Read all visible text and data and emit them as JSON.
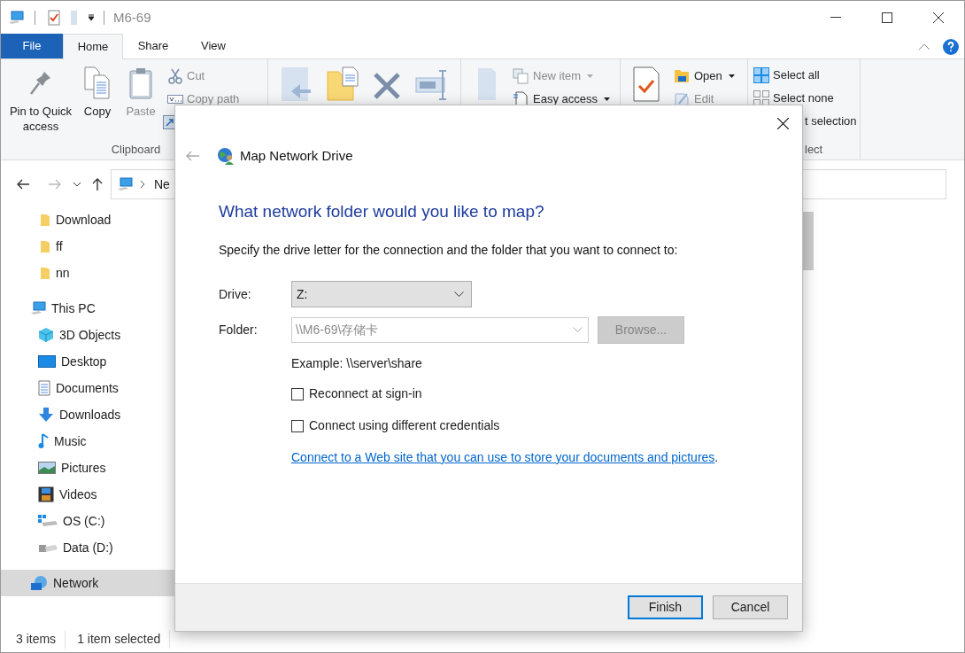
{
  "window": {
    "title": "M6-69"
  },
  "ribbon_tabs": [
    {
      "label": "File",
      "kind": "file",
      "selected": false
    },
    {
      "label": "Home",
      "kind": "tab",
      "selected": true
    },
    {
      "label": "Share",
      "kind": "tab",
      "selected": false
    },
    {
      "label": "View",
      "kind": "tab",
      "selected": false
    }
  ],
  "ribbon": {
    "clipboard": {
      "label": "Clipboard",
      "large_buttons": [
        {
          "label": "Pin to Quick access",
          "disabled": false
        },
        {
          "label": "Copy",
          "disabled": false
        },
        {
          "label": "Paste",
          "disabled": true
        }
      ],
      "small_buttons": [
        {
          "label": "Cut",
          "disabled": true
        },
        {
          "label": "Copy path",
          "disabled": true
        }
      ]
    },
    "new": {
      "small_buttons": [
        {
          "label": "New item",
          "disabled": true,
          "dropdown": true
        },
        {
          "label": "Easy access",
          "disabled": false,
          "dropdown": true
        }
      ]
    },
    "open": {
      "small_buttons": [
        {
          "label": "Open",
          "disabled": false,
          "dropdown": true
        },
        {
          "label": "Edit",
          "disabled": true,
          "dropdown": false
        }
      ]
    },
    "select": {
      "label": "lect",
      "small_buttons": [
        {
          "label": "Select all"
        },
        {
          "label": "Select none"
        },
        {
          "label": "t selection"
        }
      ]
    }
  },
  "address_bar": {
    "path": "Ne"
  },
  "nav_pane": {
    "quick_access_items": [
      {
        "label": "Download",
        "selected": false
      },
      {
        "label": "ff",
        "selected": false
      },
      {
        "label": "nn",
        "selected": false
      }
    ],
    "items": [
      {
        "label": "This PC",
        "selected": false,
        "children": [
          {
            "label": "3D Objects",
            "selected": false
          },
          {
            "label": "Desktop",
            "selected": false
          },
          {
            "label": "Documents",
            "selected": false
          },
          {
            "label": "Downloads",
            "selected": false
          },
          {
            "label": "Music",
            "selected": false
          },
          {
            "label": "Pictures",
            "selected": false
          },
          {
            "label": "Videos",
            "selected": false
          },
          {
            "label": "OS (C:)",
            "selected": false
          },
          {
            "label": "Data (D:)",
            "selected": false
          }
        ]
      },
      {
        "label": "Network",
        "selected": true
      }
    ]
  },
  "status_bar": {
    "item_count": "3 items",
    "selection": "1 item selected"
  },
  "dialog": {
    "title": "Map Network Drive",
    "heading": "What network folder would you like to map?",
    "instruction": "Specify the drive letter for the connection and the folder that you want to connect to:",
    "drive": {
      "label": "Drive:",
      "value": "Z:"
    },
    "folder": {
      "label": "Folder:",
      "value": "\\\\M6-69\\存储卡",
      "disabled": true
    },
    "browse_button": {
      "label": "Browse...",
      "disabled": true
    },
    "example": "Example: \\\\server\\share",
    "options": [
      {
        "label": "Reconnect at sign-in",
        "checked": false
      },
      {
        "label": "Connect using different credentials",
        "checked": false
      }
    ],
    "link": {
      "text": "Connect to a Web site that you can use to store your documents and pictures",
      "suffix": "."
    },
    "buttons": [
      {
        "label": "Finish",
        "default": true
      },
      {
        "label": "Cancel",
        "default": false
      }
    ]
  }
}
